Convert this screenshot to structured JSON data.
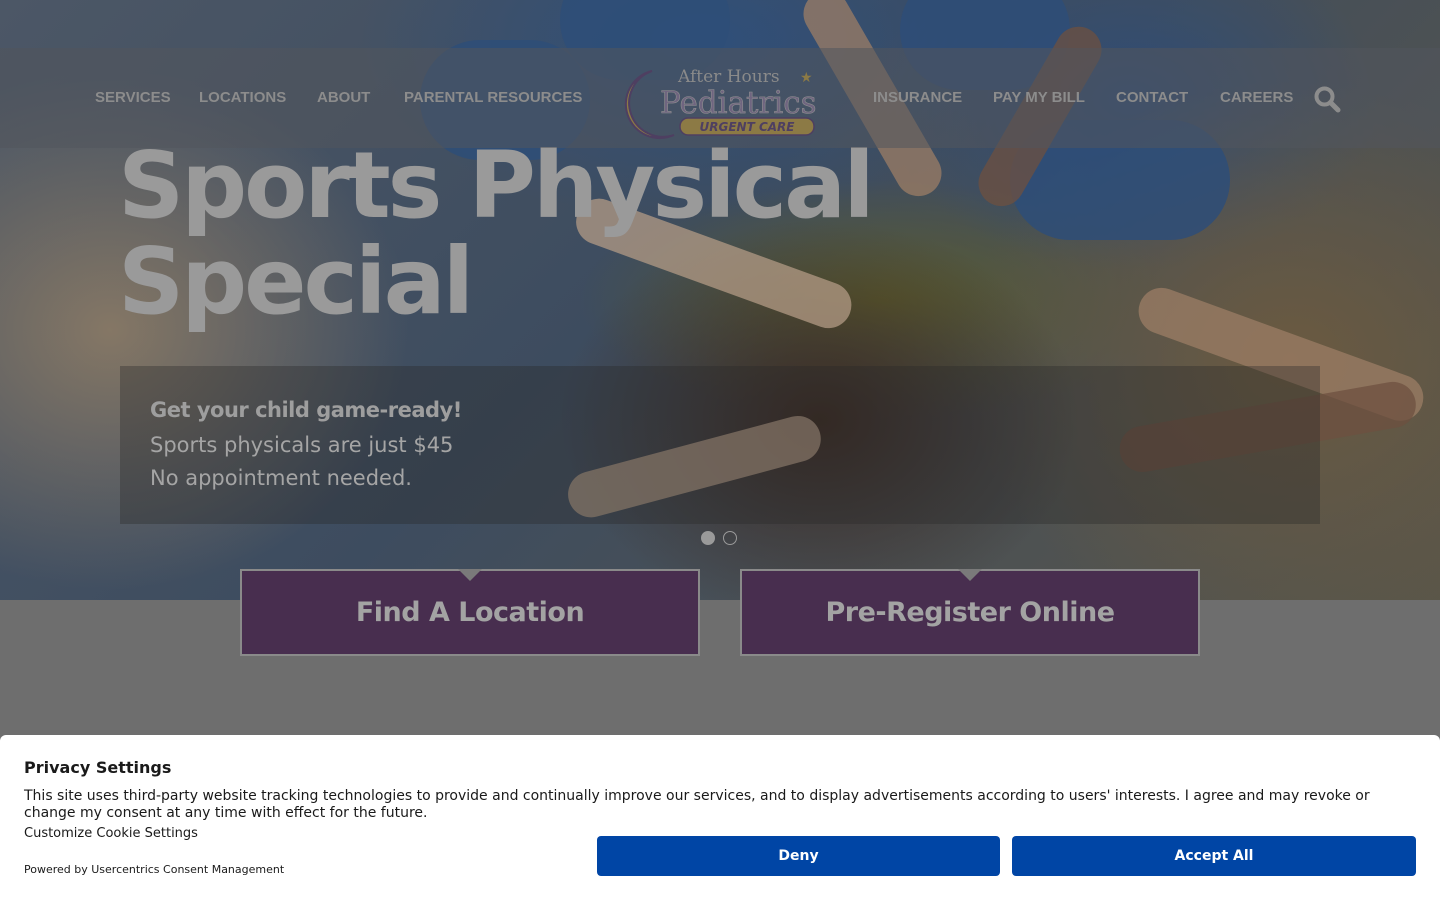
{
  "nav": {
    "left": [
      "SERVICES",
      "LOCATIONS",
      "ABOUT",
      "PARENTAL RESOURCES"
    ],
    "right": [
      "INSURANCE",
      "PAY MY BILL",
      "CONTACT",
      "CAREERS"
    ],
    "search_icon": "search-icon"
  },
  "logo": {
    "line1": "After Hours",
    "line2": "Pediatrics",
    "line3": "URGENT CARE"
  },
  "hero": {
    "title_line1": "Sports Physical",
    "title_line2": "Special",
    "caption_heading": "Get your child game-ready!",
    "caption_line1": "Sports physicals are just $45",
    "caption_line2": "No appointment needed.",
    "slide_count": 2,
    "active_slide": 1
  },
  "cta": {
    "find_location": "Find A Location",
    "pre_register": "Pre-Register Online"
  },
  "consent": {
    "title": "Privacy Settings",
    "text": "This site uses third-party website tracking technologies to provide and continually improve our services, and to display advertisements according to users' interests. I agree and may revoke or change my consent at any time with effect for the future.",
    "customize_link": "Customize Cookie Settings",
    "powered_by": "Powered by Usercentrics Consent Management",
    "deny_label": "Deny",
    "accept_label": "Accept All"
  },
  "colors": {
    "cta_bg": "#482e4f",
    "consent_button": "#0045a5",
    "logo_purple": "#5b3e7a",
    "logo_gold": "#e3b43a"
  }
}
